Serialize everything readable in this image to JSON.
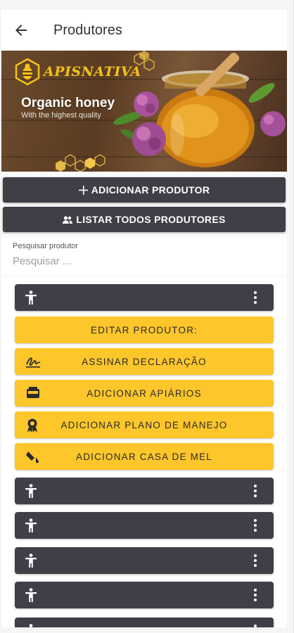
{
  "appbar": {
    "title": "Produtores",
    "back_icon": "arrow-back-icon"
  },
  "banner": {
    "logo": "APISNATIVA",
    "title": "Organic honey",
    "subtitle": "With the highest quality",
    "colors": {
      "logo": "#f1c21b",
      "honey": "#d98a16"
    }
  },
  "actions": {
    "add_label": "ADICIONAR PRODUTOR",
    "list_label": "LISTAR TODOS PRODUTORES"
  },
  "search": {
    "label": "Pesquisar produtor",
    "placeholder": "Pesquisar ..."
  },
  "menu": {
    "edit_label": "EDITAR PRODUTOR:",
    "items": [
      {
        "label": "ASSINAR DECLARAÇÃO",
        "icon": "signature-icon"
      },
      {
        "label": "ADICIONAR APIÁRIOS",
        "icon": "apiary-icon"
      },
      {
        "label": "ADICIONAR PLANO DE MANEJO",
        "icon": "award-icon"
      },
      {
        "label": "ADICIONAR CASA DE MEL",
        "icon": "honey-house-icon"
      }
    ]
  },
  "colors": {
    "dark": "#3f3f47",
    "yellow": "#fdc62b"
  }
}
